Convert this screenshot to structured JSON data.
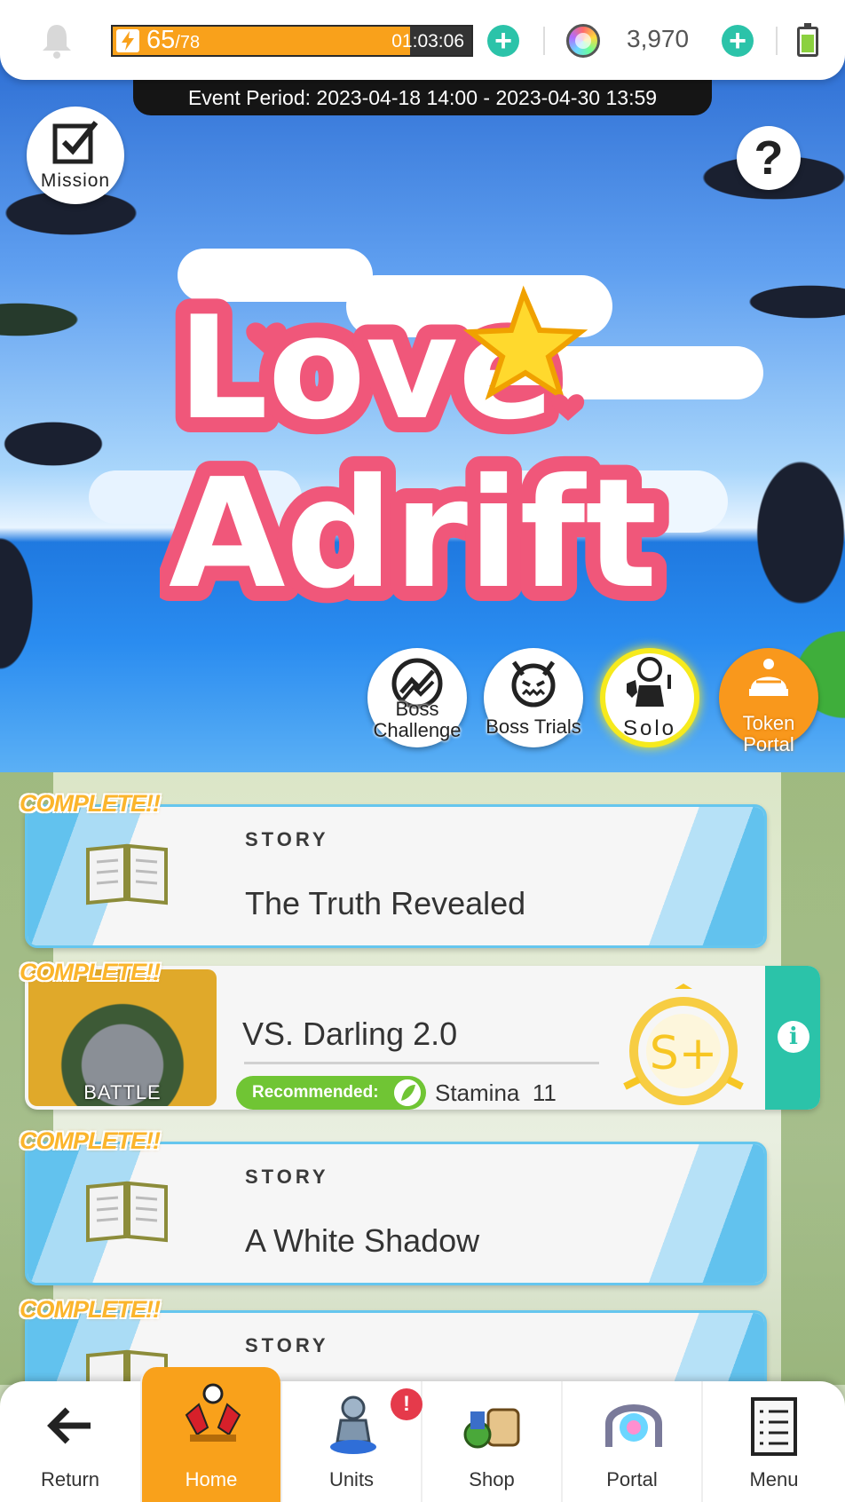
{
  "header": {
    "stamina_current": "65",
    "stamina_max": "/78",
    "stamina_fraction": 0.83,
    "stamina_timer": "01:03:06",
    "gem_count": "3,970"
  },
  "banner": {
    "event_period": "Event Period: 2023-04-18 14:00 - 2023-04-30 13:59",
    "mission_label": "Mission",
    "help_label": "?",
    "logo_line1": "Love",
    "logo_line2": "Adrift",
    "modes": [
      {
        "label_line1": "Boss",
        "label_line2": "Challenge"
      },
      {
        "label_line1": "Boss Trials"
      },
      {
        "label_line1": "Solo"
      },
      {
        "label_line1": "Token",
        "label_line2": "Portal"
      }
    ]
  },
  "quests": [
    {
      "complete": "COMPLETE!!",
      "kind": "STORY",
      "title": "The Truth Revealed"
    },
    {
      "complete": "COMPLETE!!",
      "thumb_label": "BATTLE",
      "title": "VS. Darling 2.0",
      "recommended": "Recommended:",
      "stamina_label": "Stamina",
      "stamina_cost": "11",
      "rank": "S+"
    },
    {
      "complete": "COMPLETE!!",
      "kind": "STORY",
      "title": "A White Shadow"
    },
    {
      "complete": "COMPLETE!!",
      "kind": "STORY"
    }
  ],
  "nav": {
    "items": [
      {
        "label": "Return",
        "icon": "arrow-left-icon"
      },
      {
        "label": "Home",
        "icon": "home-icon"
      },
      {
        "label": "Units",
        "icon": "unit-icon"
      },
      {
        "label": "Shop",
        "icon": "shop-icon"
      },
      {
        "label": "Portal",
        "icon": "portal-icon"
      },
      {
        "label": "Menu",
        "icon": "menu-list-icon"
      }
    ],
    "alert": "!"
  },
  "colors": {
    "accent_orange": "#f9a11b",
    "accent_teal": "#2bc3a9",
    "story_blue": "#62c2ee",
    "logo_pink": "#f0577a"
  }
}
